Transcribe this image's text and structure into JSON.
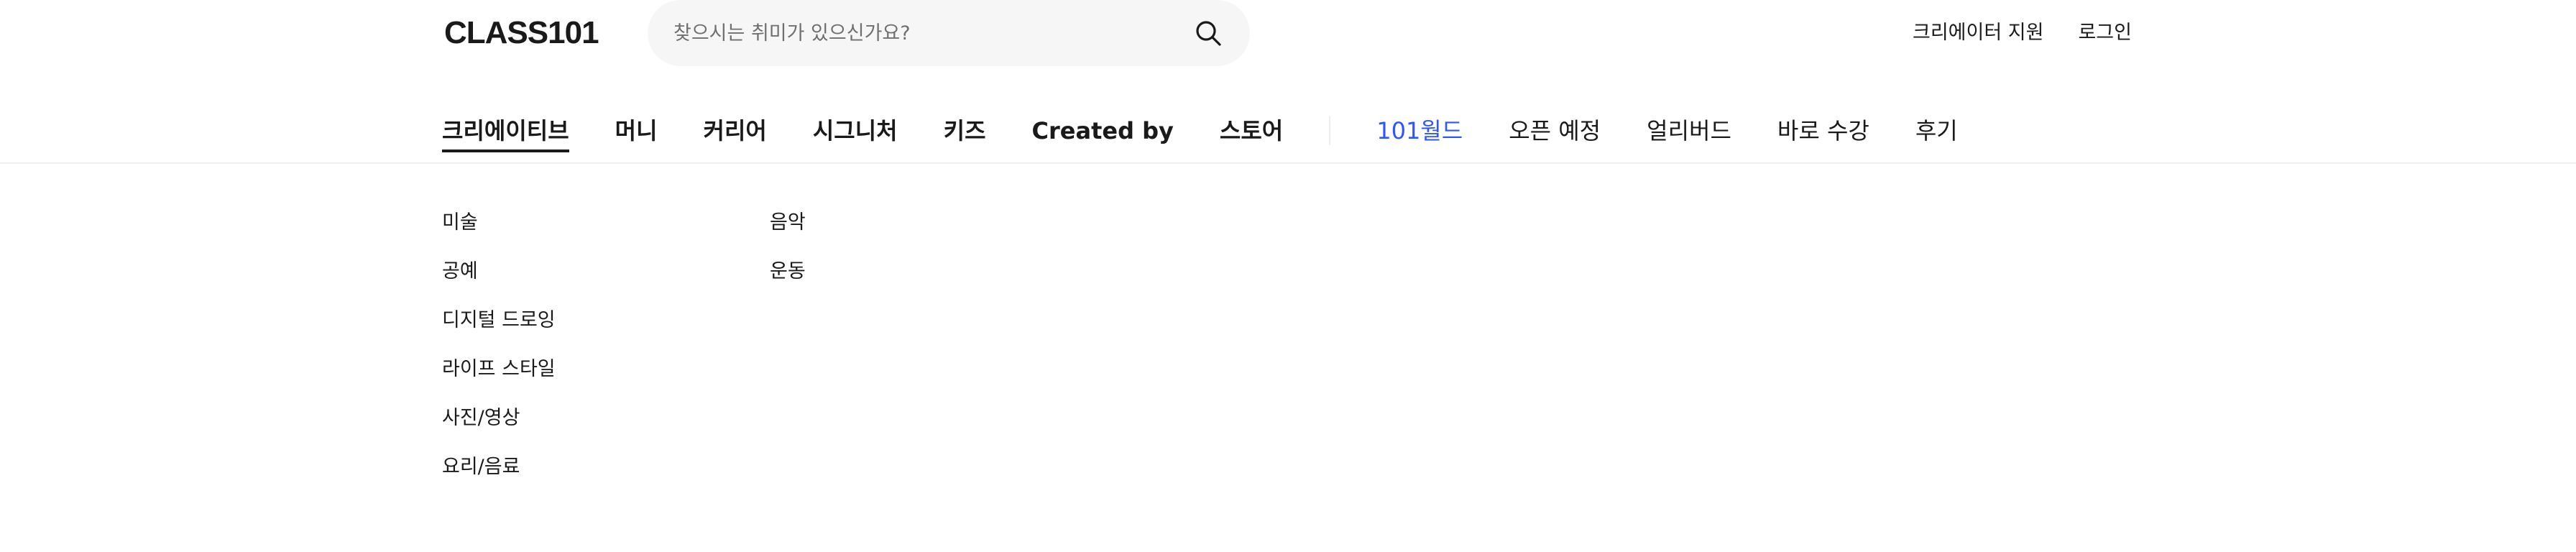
{
  "header": {
    "logo_text": "CLASS101",
    "search": {
      "placeholder": "찾으시는 취미가 있으신가요?",
      "value": ""
    },
    "links": [
      "크리에이터 지원",
      "로그인"
    ]
  },
  "nav": {
    "primary": [
      {
        "label": "크리에이티브",
        "active": true
      },
      {
        "label": "머니"
      },
      {
        "label": "커리어"
      },
      {
        "label": "시그니처"
      },
      {
        "label": "키즈"
      },
      {
        "label": "Created by"
      },
      {
        "label": "스토어"
      }
    ],
    "secondary": [
      {
        "label": "101월드",
        "highlight": true
      },
      {
        "label": "오픈 예정"
      },
      {
        "label": "얼리버드"
      },
      {
        "label": "바로 수강"
      },
      {
        "label": "후기"
      }
    ]
  },
  "submenu": {
    "column1": [
      "미술",
      "공예",
      "디지털 드로잉",
      "라이프 스타일",
      "사진/영상",
      "요리/음료"
    ],
    "column2": [
      "음악",
      "운동"
    ]
  },
  "colors": {
    "accent": "#2f55ff",
    "text": "#1a1a1a",
    "search_bg": "#f6f6f6"
  }
}
